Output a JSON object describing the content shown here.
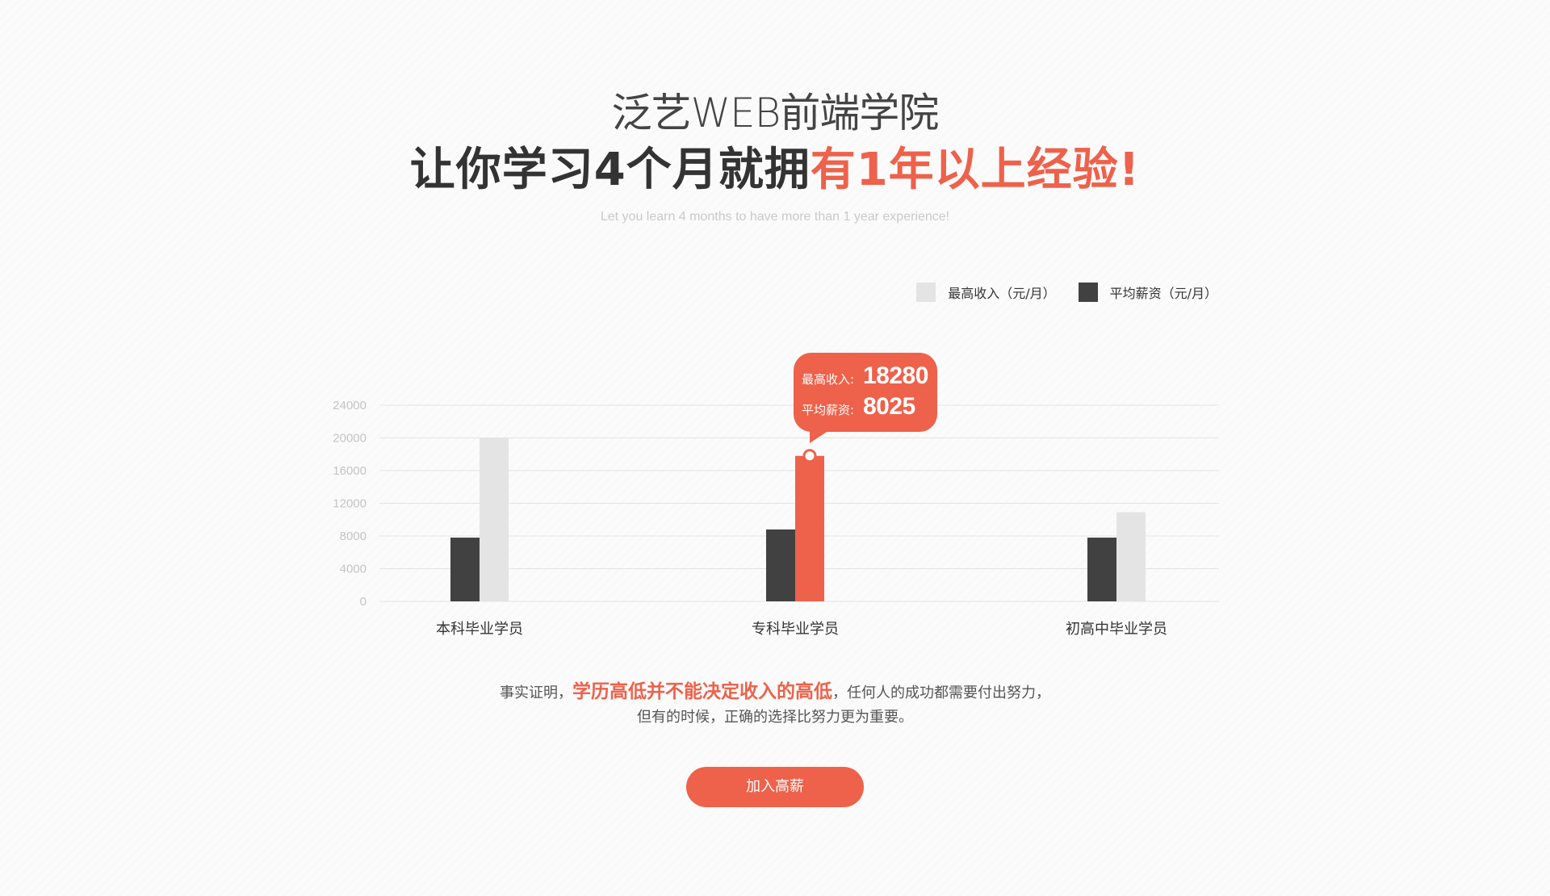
{
  "header": {
    "brand": "泛艺WEB前端学院",
    "headline_dark": "让你学习4个月就拥",
    "headline_red": "有1年以上经验!",
    "subtitle": "Let you learn 4 months to have more than 1 year experience!"
  },
  "legend": {
    "max_label": "最高收入（元/月）",
    "avg_label": "平均薪资（元/月）"
  },
  "colors": {
    "accent": "#ee614a",
    "dark_bar": "#414141",
    "light_bar": "#e4e4e4",
    "grid": "#e3e3e3"
  },
  "tooltip": {
    "max_label": "最高收入:",
    "max_value": "18280",
    "avg_label": "平均薪资:",
    "avg_value": "8025"
  },
  "chart_data": {
    "type": "bar",
    "categories": [
      "本科毕业学员",
      "专科毕业学员",
      "初高中毕业学员"
    ],
    "series": [
      {
        "name": "平均薪资（元/月）",
        "values": [
          7800,
          8800,
          7800
        ],
        "color": "#414141"
      },
      {
        "name": "最高收入（元/月）",
        "values": [
          20000,
          17800,
          10900
        ],
        "color": "#e4e4e4"
      }
    ],
    "highlight_category": 1,
    "highlight_color": "#ee614a",
    "ylim": [
      0,
      24000
    ],
    "yticks": [
      "0",
      "4000",
      "8000",
      "12000",
      "16000",
      "20000",
      "24000"
    ],
    "grid": true,
    "legend_position": "top-right"
  },
  "statement": {
    "line1_pre": "事实证明，",
    "line1_emph": "学历高低并不能决定收入的高低",
    "line1_post": "，任何人的成功都需要付出努力，",
    "line2": "但有的时候，正确的选择比努力更为重要。"
  },
  "cta": {
    "label": "加入高薪"
  }
}
